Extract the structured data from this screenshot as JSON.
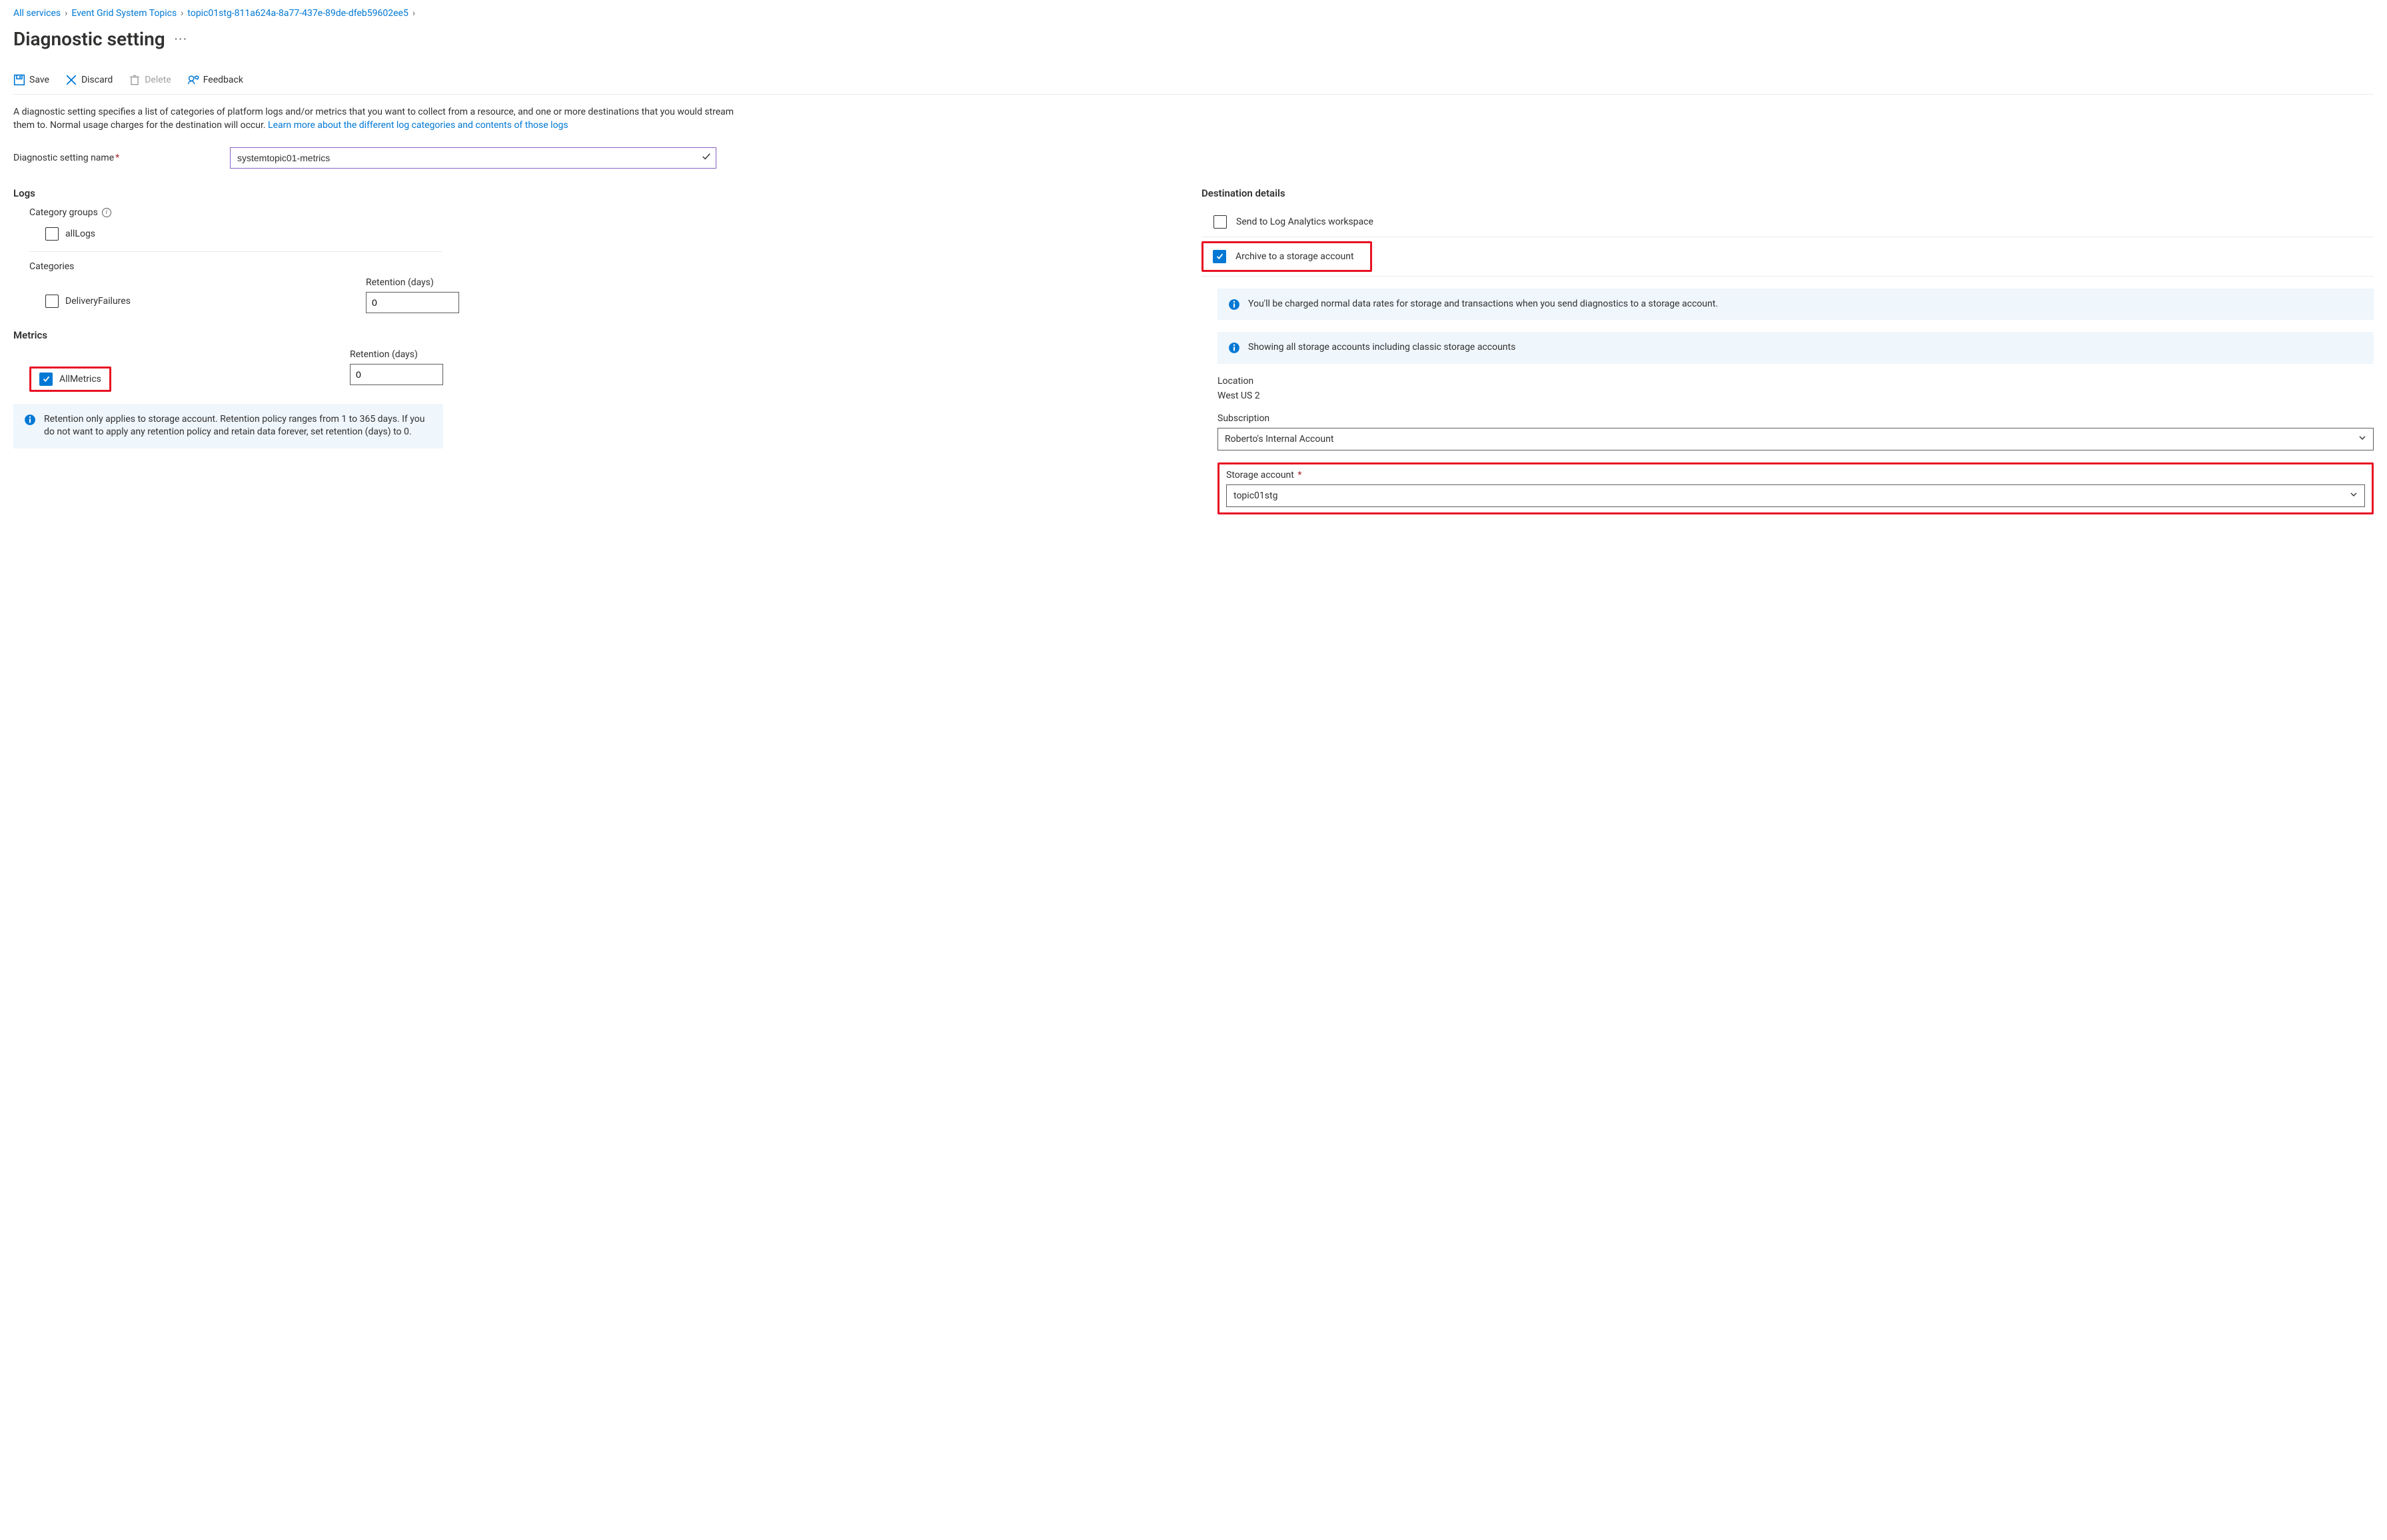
{
  "breadcrumb": {
    "items": [
      "All services",
      "Event Grid System Topics",
      "topic01stg-811a624a-8a77-437e-89de-dfeb59602ee5"
    ]
  },
  "page_title": "Diagnostic setting",
  "more_icon_label": "···",
  "toolbar": {
    "save": "Save",
    "discard": "Discard",
    "delete": "Delete",
    "feedback": "Feedback"
  },
  "description_text": "A diagnostic setting specifies a list of categories of platform logs and/or metrics that you want to collect from a resource, and one or more destinations that you would stream them to. Normal usage charges for the destination will occur. ",
  "learn_more_link": "Learn more about the different log categories and contents of those logs",
  "setting_name_label": "Diagnostic setting name",
  "setting_name_value": "systemtopic01-metrics",
  "logs": {
    "heading": "Logs",
    "category_groups_label": "Category groups",
    "all_logs_label": "allLogs",
    "categories_label": "Categories",
    "delivery_failures_label": "DeliveryFailures",
    "retention_label_1": "Retention (days)",
    "retention_value_1": "0"
  },
  "metrics": {
    "heading": "Metrics",
    "all_metrics_label": "AllMetrics",
    "retention_label": "Retention (days)",
    "retention_value": "0"
  },
  "retention_note": "Retention only applies to storage account. Retention policy ranges from 1 to 365 days. If you do not want to apply any retention policy and retain data forever, set retention (days) to 0.",
  "destination": {
    "heading": "Destination details",
    "send_workspace_label": "Send to Log Analytics workspace",
    "archive_storage_label": "Archive to a storage account",
    "charge_note": "You'll be charged normal data rates for storage and transactions when you send diagnostics to a storage account.",
    "showing_note": "Showing all storage accounts including classic storage accounts",
    "location_label": "Location",
    "location_value": "West US 2",
    "subscription_label": "Subscription",
    "subscription_value": "Roberto's Internal Account",
    "storage_account_label": "Storage account",
    "storage_account_value": "topic01stg"
  }
}
